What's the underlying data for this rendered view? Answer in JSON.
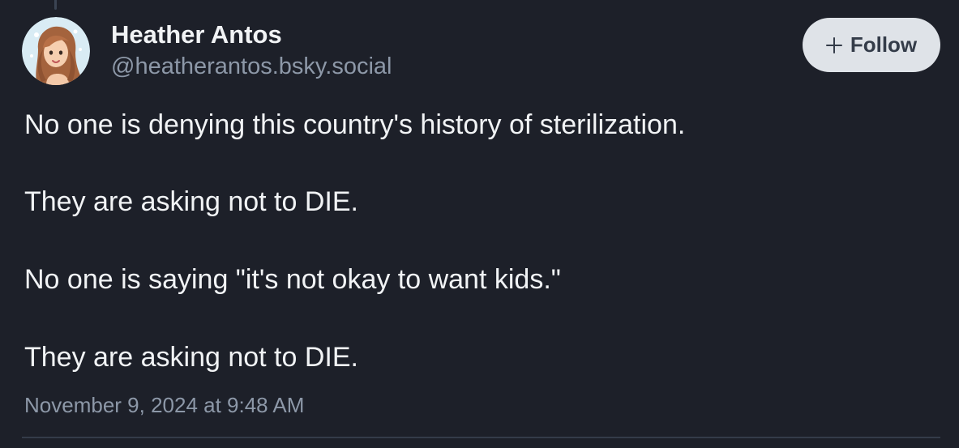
{
  "post": {
    "author": {
      "display_name": "Heather Antos",
      "handle": "@heatherantos.bsky.social",
      "avatar_icon": "avatar-illustration"
    },
    "follow_button": {
      "label": "Follow",
      "icon": "plus-icon"
    },
    "paragraphs": [
      "No one is denying this country's history of sterilization.",
      "They are asking not to DIE.",
      "No one is saying \"it's not okay to want kids.\"",
      "They are asking not to DIE."
    ],
    "timestamp": "November 9, 2024 at 9:48 AM"
  },
  "colors": {
    "background": "#1d2029",
    "text_primary": "#f1f3f5",
    "text_secondary": "#8d98a8",
    "button_background": "#dfe3e8",
    "button_text": "#343c49"
  }
}
